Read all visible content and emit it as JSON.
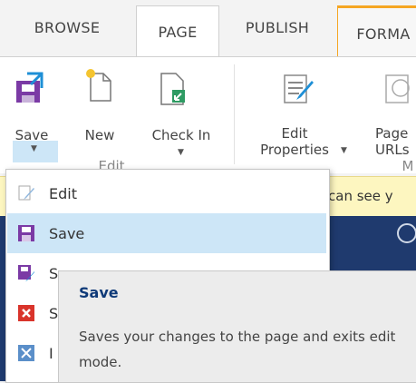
{
  "tabs": [
    {
      "label": "BROWSE"
    },
    {
      "label": "PAGE"
    },
    {
      "label": "PUBLISH"
    },
    {
      "label": "FORMA"
    }
  ],
  "ribbon": {
    "save_label": "Save",
    "new_label": "New",
    "checkin_label": "Check In",
    "edit_props_label_1": "Edit",
    "edit_props_label_2": "Properties",
    "page_urls_label_1": "Page",
    "page_urls_label_2": "URLs",
    "group_edit_label": "Edit",
    "group_manage_label": "M"
  },
  "status_bar": {
    "text": "can see y"
  },
  "menu": {
    "items": [
      {
        "label": "Edit",
        "icon": "pencil-doc-icon"
      },
      {
        "label": "Save",
        "icon": "floppy-disk-icon"
      },
      {
        "label": "S",
        "icon": "save-edit-icon"
      },
      {
        "label": "S",
        "icon": "red-x-icon"
      },
      {
        "label": "I",
        "icon": "tools-icon"
      }
    ]
  },
  "tooltip": {
    "title": "Save",
    "description": "Saves your changes to the page and exits edit mode."
  }
}
